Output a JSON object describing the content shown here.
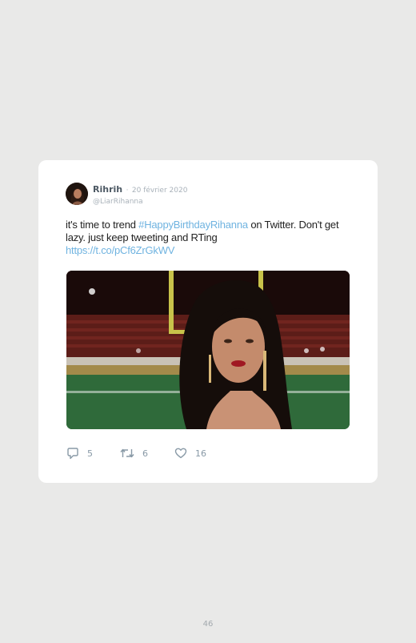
{
  "tweet": {
    "author": {
      "display_name": "Rihrih",
      "handle": "@LiarRihanna",
      "avatar_icon": "user-avatar"
    },
    "date_separator": "·",
    "date": "20 février 2020",
    "text_before": "it's time to trend ",
    "hashtag": "#HappyBirthdayRihanna",
    "text_after": " on Twitter. Don't get lazy. just keep tweeting and RTing",
    "url": "https://t.co/pCf6ZrGkWV",
    "link_color": "#6fb3e0",
    "actions": {
      "reply_count": "5",
      "reply_icon": "reply-icon",
      "retweet_count": "6",
      "retweet_icon": "retweet-icon",
      "like_count": "16",
      "like_icon": "heart-icon"
    }
  },
  "page": {
    "number": "46"
  }
}
